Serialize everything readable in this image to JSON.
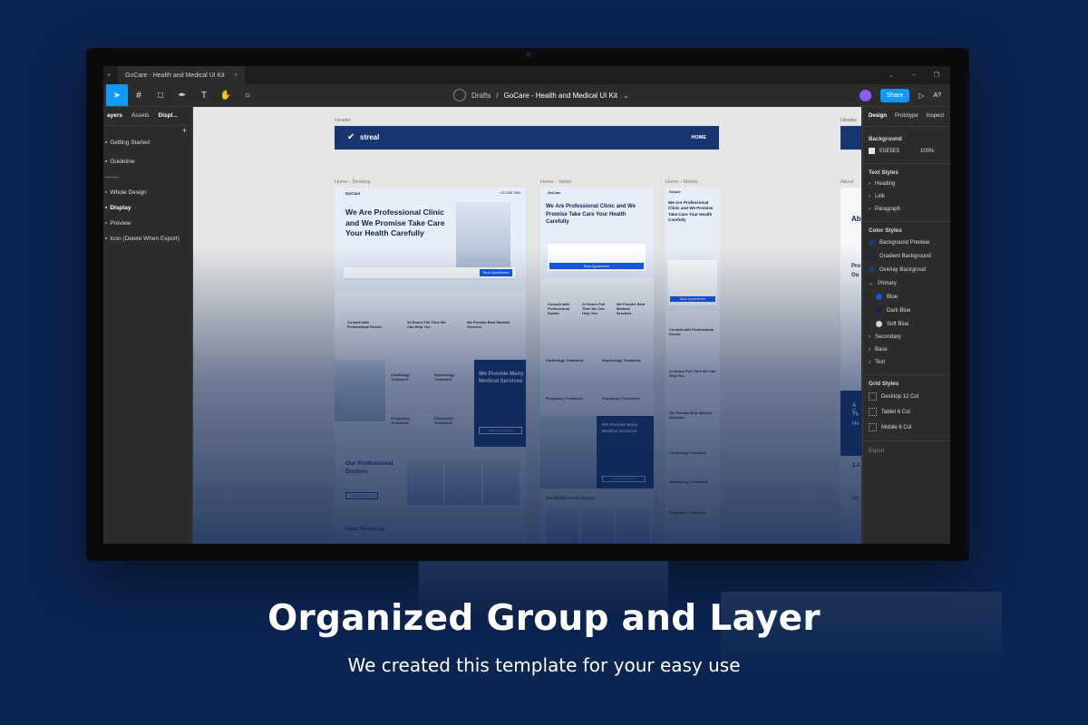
{
  "caption": {
    "title": "Organized Group and Layer",
    "subtitle": "We created this template for your easy use"
  },
  "figma": {
    "tab_title": "GoCare - Health and Medical UI Kit",
    "breadcrumb": {
      "drafts": "Drafts",
      "separator": "/",
      "file": "GoCare - Health and Medical UI Kit"
    },
    "share_label": "Share",
    "avatar_text": "A?",
    "left_panel": {
      "tabs": [
        "ayers",
        "Assets",
        "Displ..."
      ],
      "items": [
        "Getting Started",
        "Guideline",
        "-------",
        "Whole Design",
        "Display",
        "Preview",
        "Icon (Delete When Export)"
      ]
    },
    "right_panel": {
      "tabs": [
        "Design",
        "Prototype",
        "Inspect"
      ],
      "background_label": "Background",
      "background_hex": "E5E5E5",
      "background_opacity": "100%",
      "text_styles_label": "Text Styles",
      "text_styles": [
        "Heading",
        "Link",
        "Paragraph"
      ],
      "color_styles_label": "Color Styles",
      "color_styles": [
        "Background Preview",
        "Gradient Background",
        "Overlay Backgroud"
      ],
      "primary_label": "Primary",
      "primary_colors": [
        {
          "name": "Blue",
          "color": "#1f4fd6"
        },
        {
          "name": "Dark Blue",
          "color": "#14264f"
        },
        {
          "name": "Soft Blue",
          "color": "#c7d6f0"
        }
      ],
      "other_groups": [
        "Secondary",
        "Base",
        "Text"
      ],
      "grid_styles_label": "Grid Styles",
      "grid_styles": [
        "Desktop 12 Col",
        "Tablet 6 Col",
        "Mobile 6 Col"
      ],
      "export_label": "Export"
    }
  },
  "canvas": {
    "frame_labels": {
      "header": "Header",
      "desktop": "Home - Desktop",
      "tablet": "Home - Tablet",
      "mobile": "Home - Mobile",
      "about": "About",
      "header2": "Header"
    },
    "header_logo": "streal",
    "header_nav": "HOME",
    "brand": "GoCare",
    "phone": "+123 456 7890",
    "hero_title": "We Are Professional Clinic and We Promise Take Care Your Health Carefully",
    "book_btn": "Book Appointment",
    "features": [
      "Consult with Professional Doctor",
      "24 Hours Full Time We Can Help You",
      "We Provide Best Medical Services"
    ],
    "services": [
      "Cardiology Treatment",
      "Nephrology Treatment",
      "Pregnancy Treatment",
      "Pulmonary Treatment"
    ],
    "provide_title": "We Provide Many Medical Services",
    "view_services": "View More Services",
    "doctors_title": "Our Professional Doctors",
    "view_doctors": "View All Doctors",
    "latest": "Latest Technology",
    "about_fragments": [
      "Ab",
      "Pro",
      "Ou",
      "A C",
      "Th",
      "He",
      "2.4",
      "Go"
    ]
  }
}
